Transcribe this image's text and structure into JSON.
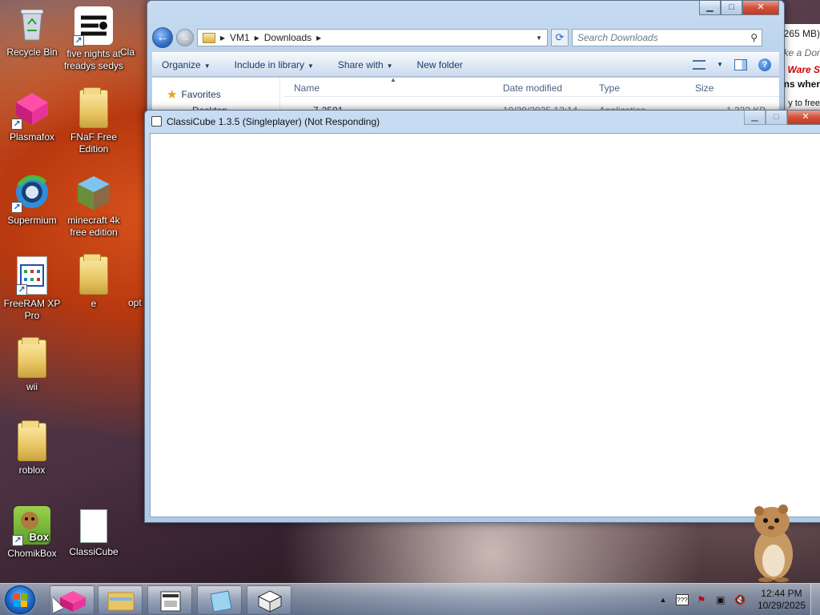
{
  "desktop": {
    "icons": [
      {
        "label": "Recycle Bin",
        "icon": "recycle-bin-icon"
      },
      {
        "label": "five nights at freadys sedys",
        "icon": "app-icon"
      },
      {
        "label": "Cla",
        "icon": "partial-icon"
      },
      {
        "label": "Plasmafox",
        "icon": "plasmafox-icon"
      },
      {
        "label": "FNaF Free Edition",
        "icon": "folder-icon"
      },
      {
        "label": "Supermium",
        "icon": "supermium-icon"
      },
      {
        "label": "minecraft 4k free edition",
        "icon": "minecraft-icon"
      },
      {
        "label": "FreeRAM XP Pro",
        "icon": "freeram-icon"
      },
      {
        "label": "e",
        "icon": "folder-icon"
      },
      {
        "label": "opt",
        "icon": "partial-icon"
      },
      {
        "label": "wii",
        "icon": "folder-icon"
      },
      {
        "label": "roblox",
        "icon": "folder-icon"
      },
      {
        "label": "ChomikBox",
        "icon": "chomikbox-icon"
      },
      {
        "label": "ClassiCube",
        "icon": "document-icon"
      }
    ],
    "chomik_badge": "Box"
  },
  "explorer": {
    "breadcrumb": [
      "VM1",
      "Downloads"
    ],
    "search_placeholder": "Search Downloads",
    "commands": [
      "Organize",
      "Include in library",
      "Share with",
      "New folder"
    ],
    "nav_favorites": "Favorites",
    "nav_partial": "Desktop",
    "columns": [
      "Name",
      "Date modified",
      "Type",
      "Size"
    ],
    "first_row": {
      "name": "7-2501",
      "date": "10/29/2025 12:14",
      "type": "Application",
      "size": "1,333 KB"
    }
  },
  "classicube": {
    "title": "ClassiCube 1.3.5 (Singleplayer) (Not Responding)"
  },
  "background_browser": {
    "size_text": "265 MB)",
    "donate_text": "ke a Dor",
    "brand_text": "Ware S",
    "where_text": "ns wher",
    "free_text": "y to free"
  },
  "taskbar": {
    "time": "12:44 PM",
    "date": "10/29/2025",
    "tray_keyboard": "???"
  },
  "colors": {
    "accent": "#1b66c9",
    "close_button": "#c23a22",
    "brand_red": "#d40000"
  }
}
